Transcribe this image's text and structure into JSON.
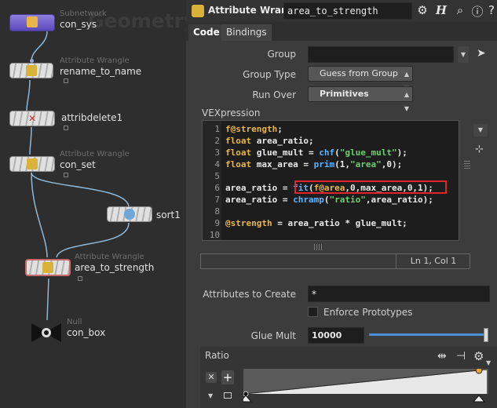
{
  "network": {
    "context_label": "Geometry",
    "nodes": [
      {
        "type": "Subnetwork",
        "name": "con_sys"
      },
      {
        "type": "Attribute Wrangle",
        "name": "rename_to_name"
      },
      {
        "type": "",
        "name": "attribdelete1"
      },
      {
        "type": "Attribute Wrangle",
        "name": "con_set"
      },
      {
        "type": "",
        "name": "sort1"
      },
      {
        "type": "Attribute Wrangle",
        "name": "area_to_strength"
      },
      {
        "type": "Null",
        "name": "con_box"
      }
    ]
  },
  "header": {
    "node_type": "Attribute Wrangle",
    "node_name": "area_to_strength",
    "icons": [
      "gear-icon",
      "help-h-icon",
      "search-icon",
      "info-icon",
      "help-icon"
    ]
  },
  "tabs": [
    {
      "label": "Code"
    },
    {
      "label": "Bindings"
    }
  ],
  "params": {
    "group": {
      "label": "Group",
      "value": ""
    },
    "group_type": {
      "label": "Group Type",
      "value": "Guess from Group"
    },
    "run_over": {
      "label": "Run Over",
      "value": "Primitives"
    },
    "vex_label": "VEXpression",
    "code_lines": [
      "f@strength;",
      "float area_ratio;",
      "float glue_mult = chf(\"glue_mult\");",
      "float max_area = prim(1,\"area\",0);",
      "",
      "area_ratio = fit(f@area,0,max_area,0,1);",
      "area_ratio = chramp(\"ratio\",area_ratio);",
      "",
      "@strength = area_ratio * glue_mult;",
      ""
    ],
    "line_numbers": [
      "1",
      "2",
      "3",
      "4",
      "5",
      "6",
      "7",
      "8",
      "9",
      "10"
    ],
    "cursor_status": "Ln 1, Col 1",
    "attribs_to_create": {
      "label": "Attributes to Create",
      "value": "*"
    },
    "enforce_prototypes": {
      "label": "Enforce Prototypes",
      "checked": false
    },
    "glue_mult": {
      "label": "Glue Mult",
      "value": "10000"
    },
    "ratio_label": "Ratio"
  },
  "colors": {
    "highlight_box": "#e0242a",
    "keyword": "#e9b64b",
    "function": "#5fb4ff",
    "string": "#6fcf6f"
  }
}
